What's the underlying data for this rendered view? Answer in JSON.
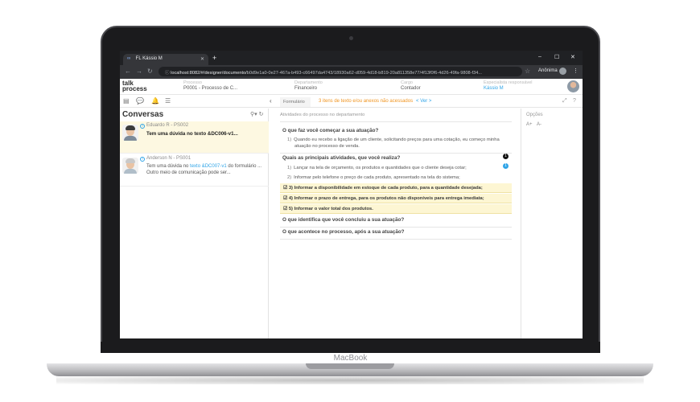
{
  "device": {
    "brand": "MacBook"
  },
  "browser": {
    "tab_title": "FL Kássio M",
    "tab_icon": "∞",
    "new_tab": "+",
    "controls": {
      "minimize": "–",
      "maximize": "☐",
      "close": "✕"
    },
    "url_host": "localhost:8082/#/designer/documento/",
    "url_path": "b0d9e1a0-0e27-467a-b493-c66497da4743/18930a62-d059-4d18-b819-20a811358e77/4f13f0f6-4d26-49fa-9808-f34...",
    "profile": "Anônima"
  },
  "header": {
    "logo_top": "talk",
    "logo_bottom": "process",
    "fields": [
      {
        "label": "Processo",
        "value": "P0001 - Processo de C..."
      },
      {
        "label": "Departamento",
        "value": "Financeiro"
      },
      {
        "label": "Cargo",
        "value": "Contador"
      },
      {
        "label": "Especialista responsável",
        "value": "Kássio M"
      }
    ]
  },
  "toolbar": {
    "form_tab": "Formulário",
    "warning": "3 itens de texto e/ou anexos não acessados",
    "prev": "<",
    "ver": "Ver",
    "next": ">"
  },
  "conversations": {
    "title": "Conversas",
    "items": [
      {
        "name": "Eduardo R - PS002",
        "message": "Tem uma dúvida no texto &DC006-v1..."
      },
      {
        "name": "Anderson N - PS001",
        "message_prefix": "Tem uma dúvida no ",
        "message_link": "texto &DC007-v1",
        "message_suffix": " do formulário ...",
        "message_line2": "Outro meio de comunicação pode ser..."
      }
    ]
  },
  "content": {
    "subtitle": "Atividades do processo no departamento",
    "q1": "O que faz você começar a sua atuação?",
    "a1_num": "1)",
    "a1_line1": "Quando eu recebo a ligação de um cliente, solicitando preços para uma cotação, eu começo minha",
    "a1_line2": "atuação no processo de venda.",
    "q2": "Quais as principais atividades, que você realiza?",
    "list": [
      {
        "num": "1)",
        "text": "Lançar na tela de orçamento, os produtos e quantidades que o cliente deseja cotar;"
      },
      {
        "num": "2)",
        "text": "Informar pelo telefone o preço de cada produto, apresentado na tela do sistema;"
      }
    ],
    "highlighted": [
      {
        "num": "3)",
        "text": "Informar a disponibilidade em estoque de cada produto, para a quantidade desejada;"
      },
      {
        "num": "4)",
        "text": "Informar o prazo de entrega, para os produtos não disponíveis para entrega imediata;"
      },
      {
        "num": "5)",
        "text": "Informar o valor total dos produtos."
      }
    ],
    "badge1": "1",
    "badge2": "1",
    "q3": "O que identifica que você concluiu a sua atuação?",
    "q4": "O que acontece no processo, após a sua atuação?"
  },
  "options": {
    "title": "Opções",
    "increase": "A+",
    "decrease": "A-"
  },
  "colors": {
    "accent": "#2fa4e7",
    "warning": "#f0941f",
    "highlight": "#fdf6d3",
    "selected": "#fdf8e1"
  }
}
